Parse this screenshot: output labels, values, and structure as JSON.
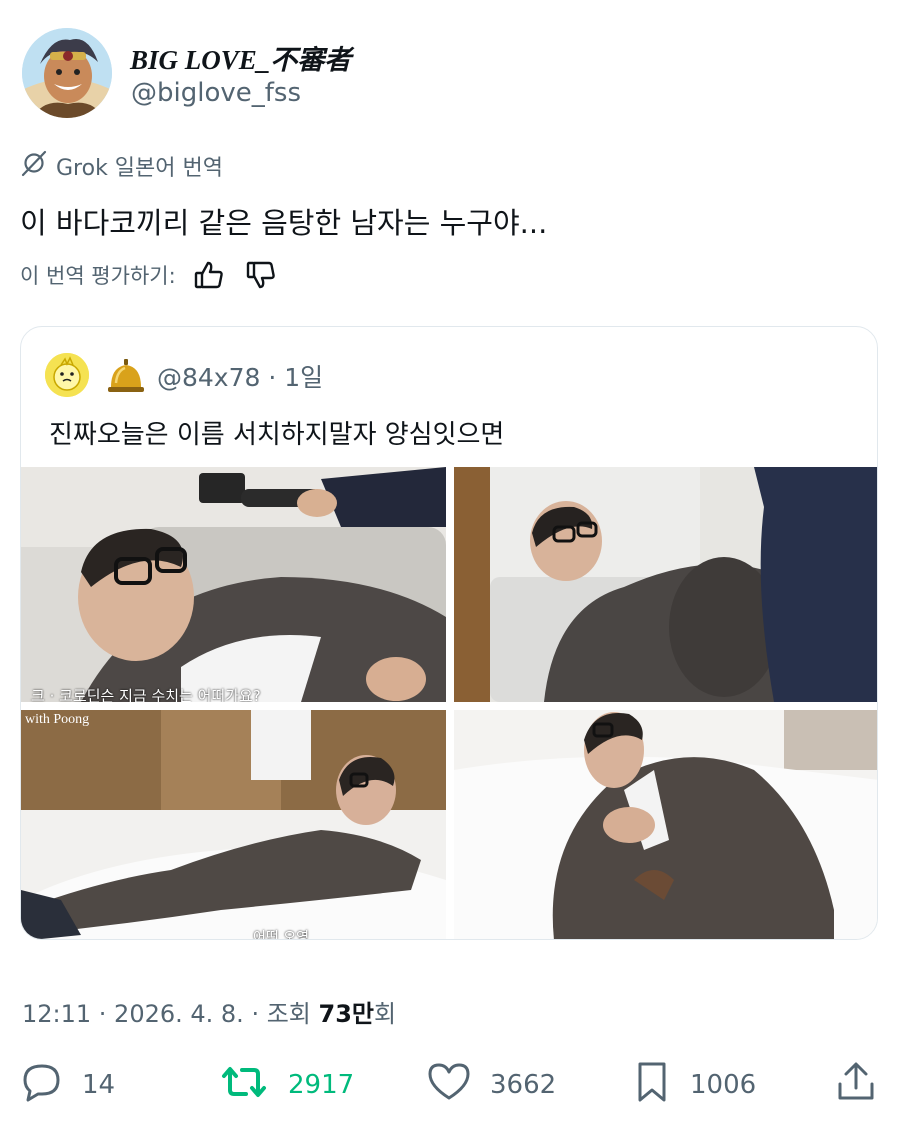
{
  "author": {
    "display_name": "BIG LOVE_不審者",
    "handle": "@biglove_fss"
  },
  "translation": {
    "label": "Grok 일본어 번역",
    "text": "이 바다코끼리 같은 음탕한 남자는 누구야...",
    "rate_label": "이 번역 평가하기:"
  },
  "quote": {
    "meta": "@84x78 · 1일",
    "text": "진짜오늘은 이름 서치하지말자 양심잇으면",
    "photos": {
      "p1_caption": "크 · 코로딘슨 지금 수치는 어떠가요?",
      "p3_watermark_top": "with Poong",
      "p3_caption": "어떤 오영"
    }
  },
  "timestamp": {
    "prefix": "12:11 · 2026. 4. 8. · 조회 ",
    "views": "73만",
    "suffix": "회"
  },
  "actions": {
    "replies": "14",
    "reposts": "2917",
    "likes": "3662",
    "bookmarks": "1006"
  },
  "colors": {
    "repost_active": "#00ba7c",
    "secondary_text": "#536471",
    "primary_text": "#0f1419",
    "border": "#e1e8ed"
  }
}
